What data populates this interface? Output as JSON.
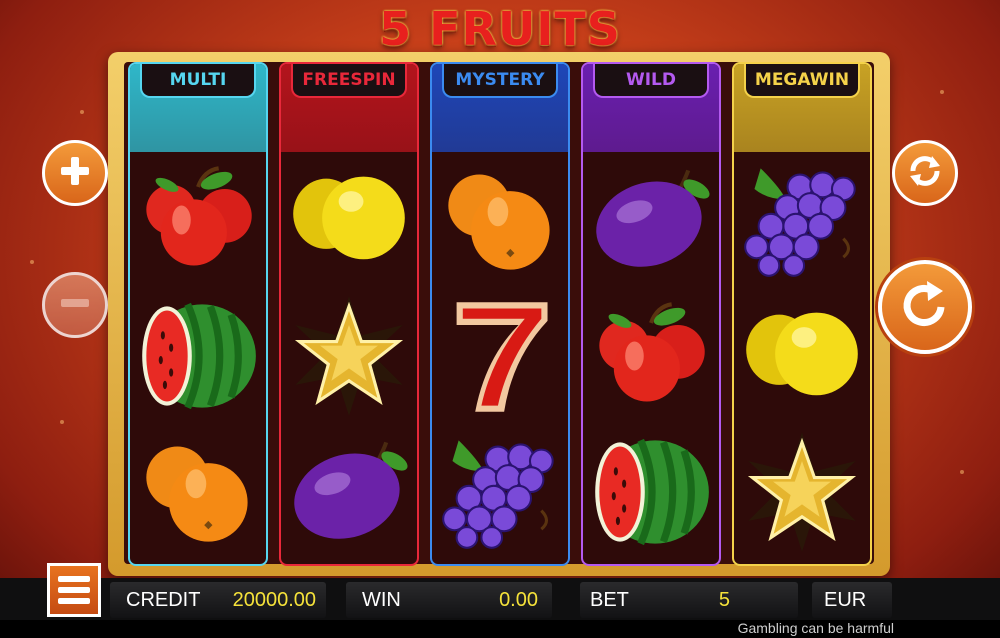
{
  "game": {
    "title": "5 FRUITS"
  },
  "reels": [
    {
      "label": "MULTI",
      "color": "#56d6f0",
      "head": "#2fb7c9",
      "symbols": [
        "apples-icon",
        "watermelon-icon",
        "oranges-icon"
      ]
    },
    {
      "label": "FREESPIN",
      "color": "#e8283a",
      "head": "#b3141c",
      "symbols": [
        "lemon-icon",
        "star-icon",
        "plum-icon"
      ]
    },
    {
      "label": "MYSTERY",
      "color": "#3b8bf0",
      "head": "#1e46b8",
      "symbols": [
        "oranges-icon",
        "seven-icon",
        "grapes-icon"
      ]
    },
    {
      "label": "WILD",
      "color": "#b45af0",
      "head": "#6a1fb0",
      "symbols": [
        "plum-icon",
        "apples-icon",
        "watermelon-icon"
      ]
    },
    {
      "label": "MEGAWIN",
      "color": "#f4d24a",
      "head": "#c8a224",
      "symbols": [
        "grapes-icon",
        "lemon-icon",
        "star-icon"
      ]
    }
  ],
  "controls": {
    "increase": "plus-icon",
    "decrease": "minus-icon",
    "autoplay": "autoplay-icon",
    "spin": "spin-icon",
    "menu": "menu-icon"
  },
  "status": {
    "credit_label": "CREDIT",
    "credit_value": "20000.00",
    "win_label": "WIN",
    "win_value": "0.00",
    "bet_label": "BET",
    "bet_value": "5",
    "currency": "EUR"
  },
  "disclaimer": "Gambling can be harmful"
}
